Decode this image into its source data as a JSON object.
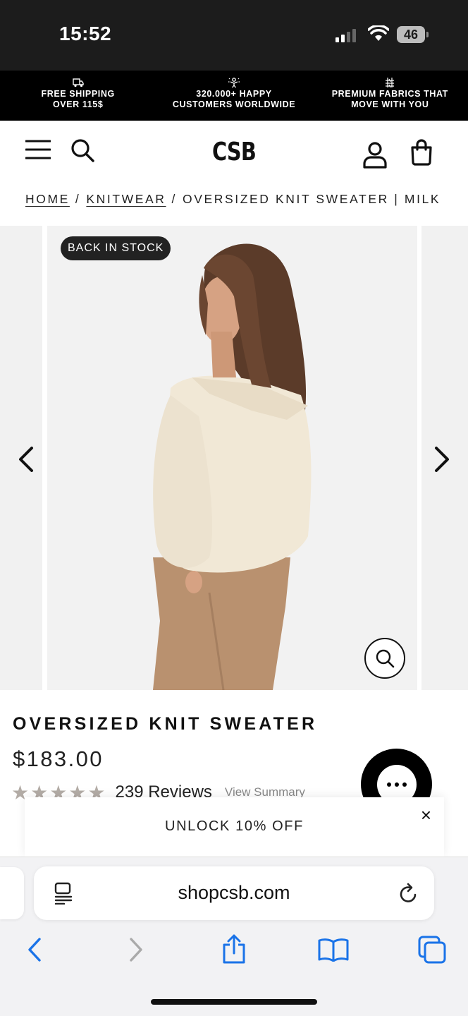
{
  "status_bar": {
    "time": "15:52",
    "battery": "46"
  },
  "promo_bar": {
    "items": [
      {
        "icon": "truck-icon",
        "line1": "FREE SHIPPING",
        "line2": "OVER 115$"
      },
      {
        "icon": "happy-person-icon",
        "line1": "320.000+ HAPPY",
        "line2": "CUSTOMERS WORLDWIDE"
      },
      {
        "icon": "fabric-icon",
        "line1": "PREMIUM FABRICS THAT",
        "line2": "MOVE WITH YOU"
      }
    ]
  },
  "header": {
    "logo": "CSB"
  },
  "breadcrumb": {
    "home": "HOME",
    "category": "KNITWEAR",
    "current": "OVERSIZED KNIT SWEATER | MILK",
    "separator": "/"
  },
  "gallery": {
    "badge": "BACK IN STOCK"
  },
  "product": {
    "title": "OVERSIZED KNIT SWEATER",
    "price": "$183.00",
    "stars": "★★★★★",
    "review_count": "239 Reviews",
    "view_summary": "View Summary"
  },
  "popup": {
    "text": "UNLOCK 10% OFF",
    "close": "×"
  },
  "browser": {
    "url": "shopcsb.com"
  },
  "colors": {
    "accent_blue": "#1a73e8",
    "badge_bg": "#222222",
    "promo_bg": "#000000"
  }
}
